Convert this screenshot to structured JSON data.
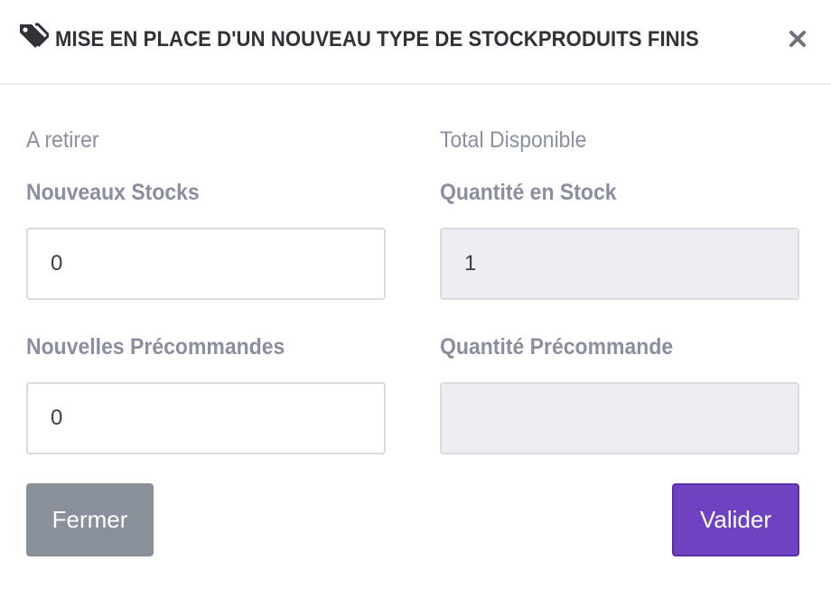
{
  "header": {
    "title": "MISE EN PLACE D'UN NOUVEAU TYPE DE STOCKPRODUITS FINIS",
    "icon": "tag-icon",
    "close_icon": "close-icon"
  },
  "left_column": {
    "section_label": "A retirer",
    "stock_label": "Nouveaux Stocks",
    "stock_value": "0",
    "preorder_label": "Nouvelles Précommandes",
    "preorder_value": "0"
  },
  "right_column": {
    "section_label": "Total Disponible",
    "stock_label": "Quantité en Stock",
    "stock_value": "1",
    "preorder_label": "Quantité Précommande",
    "preorder_value": ""
  },
  "footer": {
    "close_label": "Fermer",
    "validate_label": "Valider"
  },
  "colors": {
    "primary": "#6f42c1",
    "secondary": "#8a9099",
    "readonly_bg": "#eceef1"
  }
}
